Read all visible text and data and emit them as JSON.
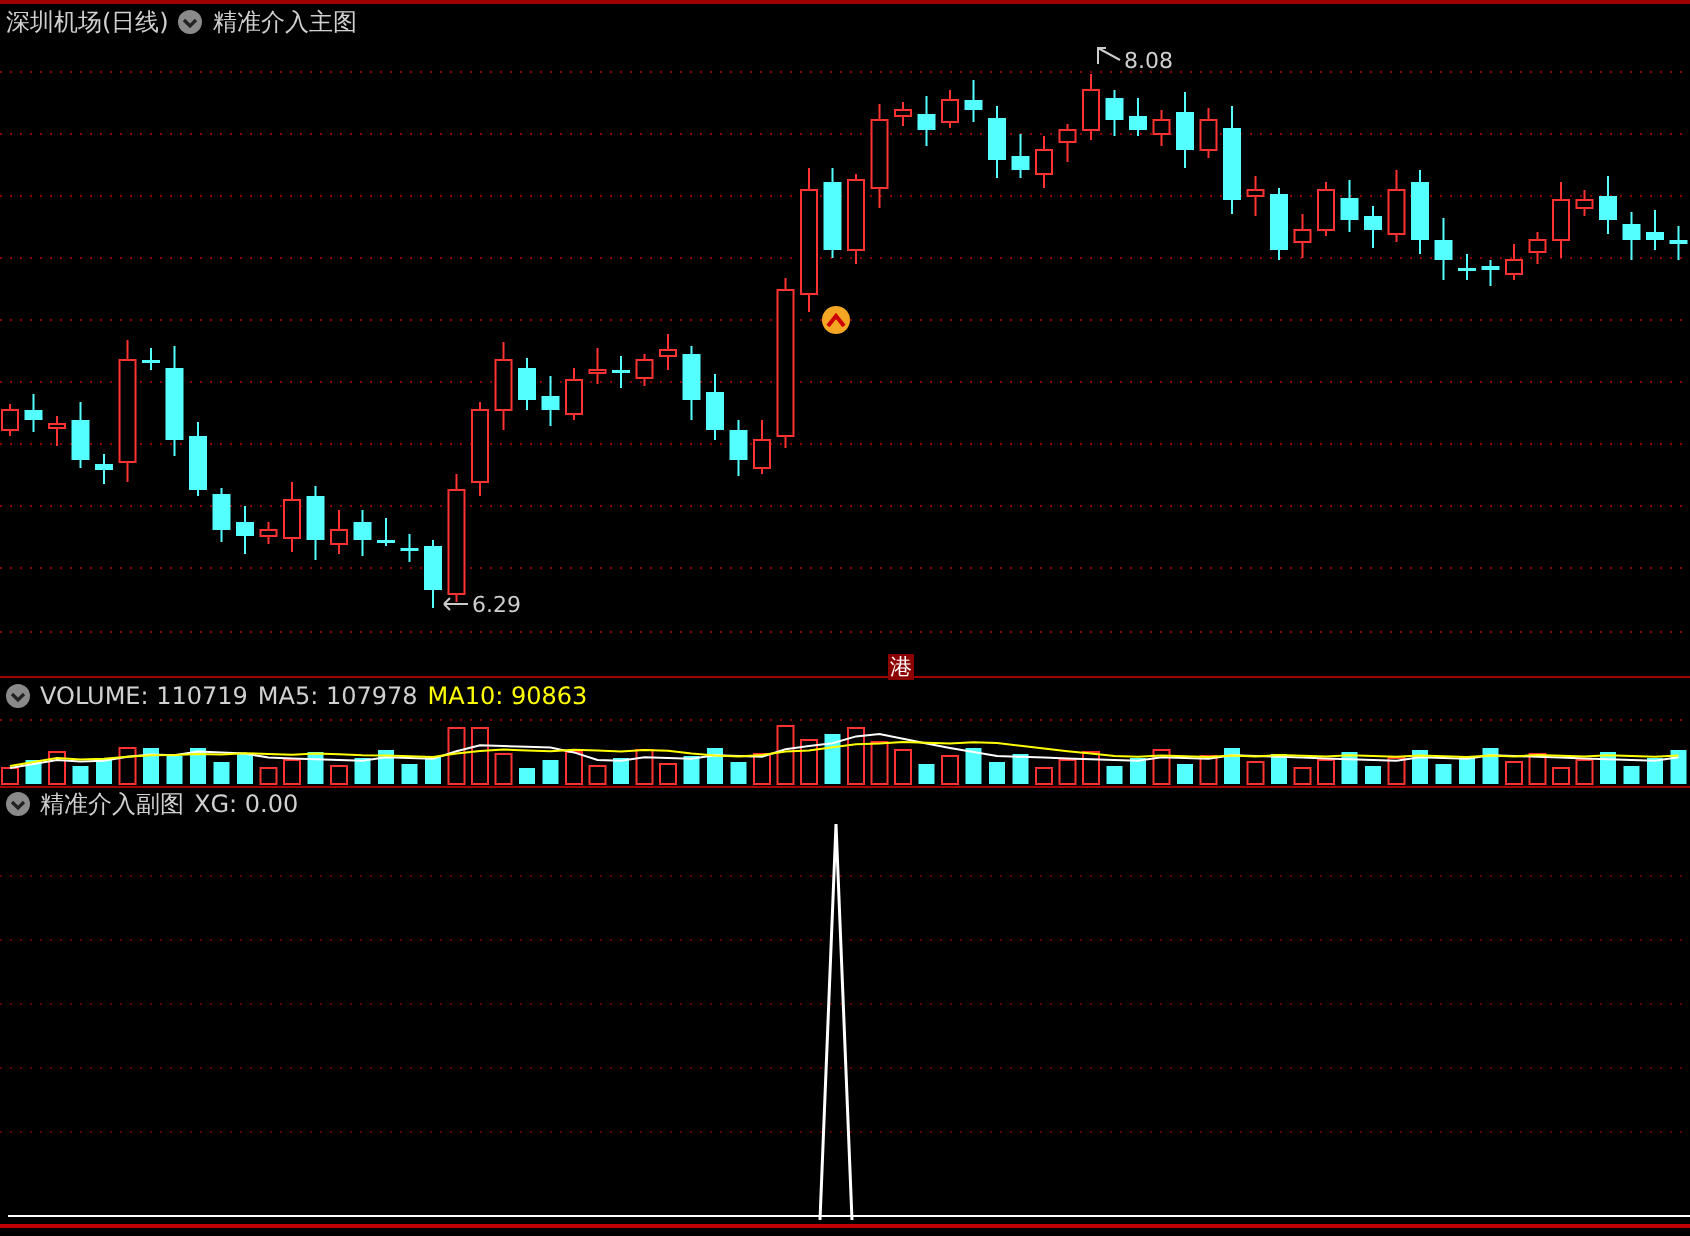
{
  "header": {
    "stock": "深圳机场(日线)",
    "indicator": "精准介入主图"
  },
  "price_chart": {
    "high_label": "8.08",
    "low_label": "6.29",
    "badge": "港"
  },
  "volume_panel": {
    "volume": "VOLUME: 110719",
    "ma5": "MA5: 107978",
    "ma10": "MA10: 90863"
  },
  "sub_panel": {
    "indicator": "精准介入副图",
    "value": "XG: 0.00"
  }
}
